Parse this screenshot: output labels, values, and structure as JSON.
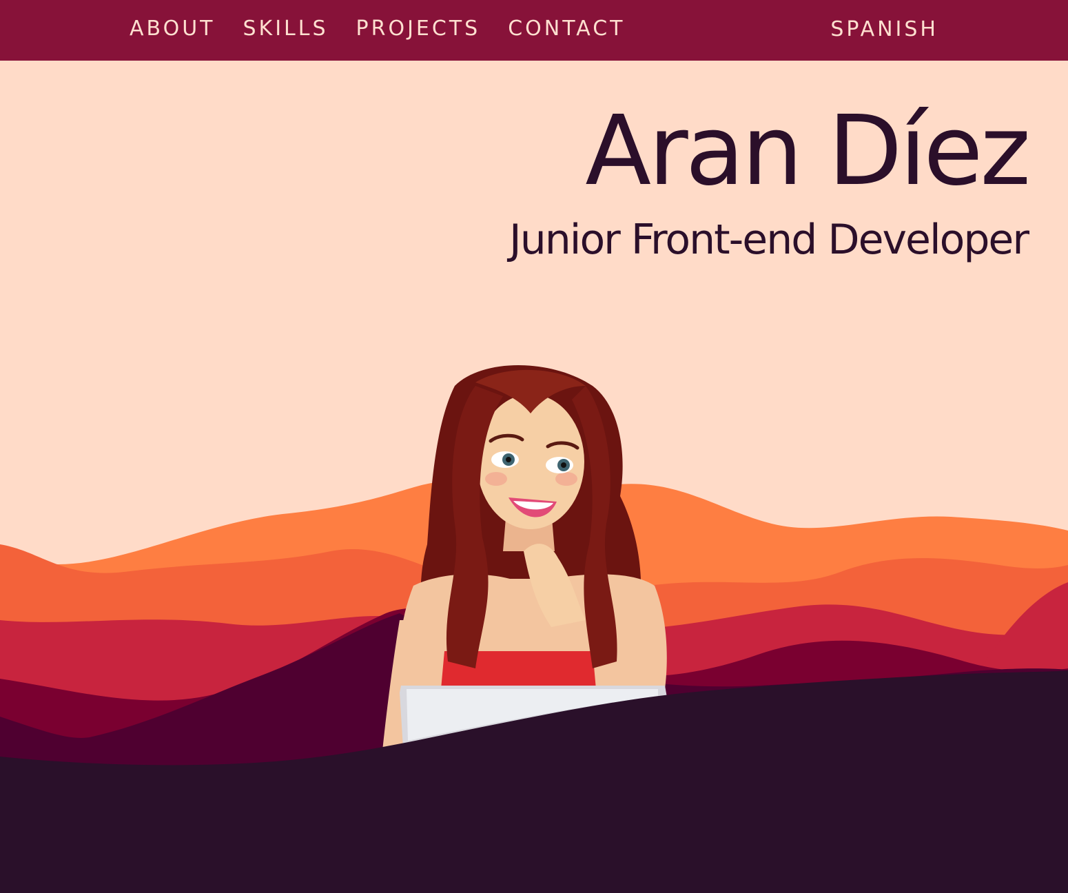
{
  "nav": {
    "links": [
      {
        "label": "ABOUT"
      },
      {
        "label": "SKILLS"
      },
      {
        "label": "PROJECTS"
      },
      {
        "label": "CONTACT"
      }
    ],
    "language_toggle": "SPANISH"
  },
  "hero": {
    "name": "Aran Díez",
    "subtitle": "Junior Front-end Developer"
  },
  "colors": {
    "navbar": "#871239",
    "background": "#ffdbc8",
    "text_dark": "#2b0f2a",
    "nav_text": "#ffe0d0"
  }
}
